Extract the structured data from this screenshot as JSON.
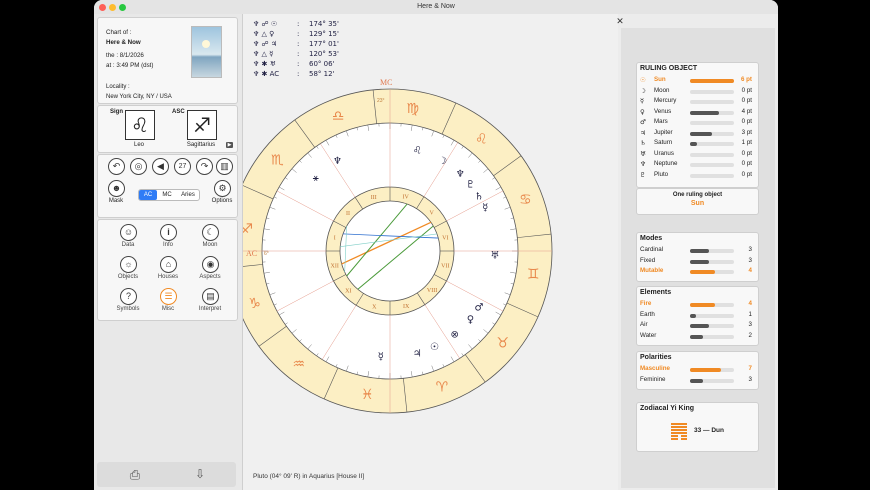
{
  "window": {
    "title": "Here & Now"
  },
  "chart_info": {
    "line1": "Chart of :",
    "line2": "Here & Now",
    "line3": "the : 8/1/2026",
    "line4": "at : 3:49 PM (dst)",
    "locality_label": "Locality :",
    "locality": "New York City, NY / USA"
  },
  "sign_box": {
    "sign_label": "Sign",
    "asc_label": "ASC",
    "sign_value": "Leo",
    "asc_value": "Sagittarius"
  },
  "toolbar": {
    "day": "27",
    "mask_label": "Mask",
    "options_label": "Options",
    "seg": [
      "AC",
      "MC",
      "Aries"
    ]
  },
  "categories": [
    {
      "label": "Data"
    },
    {
      "label": "Info"
    },
    {
      "label": "Moon"
    },
    {
      "label": "Objects"
    },
    {
      "label": "Houses"
    },
    {
      "label": "Aspects"
    },
    {
      "label": "Symbols"
    },
    {
      "label": "Misc"
    },
    {
      "label": "Interpret"
    }
  ],
  "aspects": [
    {
      "glyphs": "♆ ☍ ☉",
      "sep": ":",
      "value": "174° 35'"
    },
    {
      "glyphs": "♆ △ ♀",
      "sep": ":",
      "value": "129° 15'"
    },
    {
      "glyphs": "♆ ☍ ♃",
      "sep": ":",
      "value": "177° 01'"
    },
    {
      "glyphs": "♆ △ ☿",
      "sep": ":",
      "value": "120° 53'"
    },
    {
      "glyphs": "♆ ✱ ♅",
      "sep": ":",
      "value": "60° 06'"
    },
    {
      "glyphs": "♆ ✱ AC",
      "sep": ":",
      "value": "58° 12'"
    }
  ],
  "wheel": {
    "mc_label": "MC",
    "mc_deg": "23°",
    "ac_label": "AC",
    "ac_deg": "6°",
    "house_numerals": [
      "I",
      "II",
      "III",
      "IV",
      "V",
      "VI",
      "VII",
      "VIII",
      "IX",
      "X",
      "XI",
      "XII"
    ]
  },
  "status": {
    "text": "Pluto (04° 09' R) in Aquarius [House II]"
  },
  "ruling": {
    "title": "RULING OBJECT",
    "items": [
      {
        "glyph": "☉",
        "name": "Sun",
        "pts": "6 pt",
        "frac": 1.0,
        "highlight": true
      },
      {
        "glyph": "☽",
        "name": "Moon",
        "pts": "0 pt",
        "frac": 0,
        "highlight": false
      },
      {
        "glyph": "☿",
        "name": "Mercury",
        "pts": "0 pt",
        "frac": 0,
        "highlight": false
      },
      {
        "glyph": "♀",
        "name": "Venus",
        "pts": "4 pt",
        "frac": 0.67,
        "highlight": false
      },
      {
        "glyph": "♂",
        "name": "Mars",
        "pts": "0 pt",
        "frac": 0,
        "highlight": false
      },
      {
        "glyph": "♃",
        "name": "Jupiter",
        "pts": "3 pt",
        "frac": 0.5,
        "highlight": false
      },
      {
        "glyph": "♄",
        "name": "Saturn",
        "pts": "1 pt",
        "frac": 0.17,
        "highlight": false
      },
      {
        "glyph": "♅",
        "name": "Uranus",
        "pts": "0 pt",
        "frac": 0,
        "highlight": false
      },
      {
        "glyph": "♆",
        "name": "Neptune",
        "pts": "0 pt",
        "frac": 0,
        "highlight": false
      },
      {
        "glyph": "♇",
        "name": "Pluto",
        "pts": "0 pt",
        "frac": 0,
        "highlight": false
      }
    ]
  },
  "one_ruling": {
    "title": "One ruling object",
    "value": "Sun"
  },
  "modes": {
    "title": "Modes",
    "items": [
      {
        "name": "Cardinal",
        "count": "3",
        "frac": 0.43,
        "highlight": false
      },
      {
        "name": "Fixed",
        "count": "3",
        "frac": 0.43,
        "highlight": false
      },
      {
        "name": "Mutable",
        "count": "4",
        "frac": 0.57,
        "highlight": true
      }
    ]
  },
  "elements": {
    "title": "Elements",
    "items": [
      {
        "name": "Fire",
        "count": "4",
        "frac": 0.57,
        "highlight": true
      },
      {
        "name": "Earth",
        "count": "1",
        "frac": 0.14,
        "highlight": false
      },
      {
        "name": "Air",
        "count": "3",
        "frac": 0.43,
        "highlight": false
      },
      {
        "name": "Water",
        "count": "2",
        "frac": 0.29,
        "highlight": false
      }
    ]
  },
  "polarities": {
    "title": "Polarities",
    "items": [
      {
        "name": "Masculine",
        "count": "7",
        "frac": 0.7,
        "highlight": true
      },
      {
        "name": "Feminine",
        "count": "3",
        "frac": 0.3,
        "highlight": false
      }
    ]
  },
  "yiking": {
    "title": "Zodiacal Yi King",
    "value": "33 — Dun"
  },
  "colors": {
    "accent": "#f08a24",
    "zodiac_bg": "#fcefc4"
  }
}
